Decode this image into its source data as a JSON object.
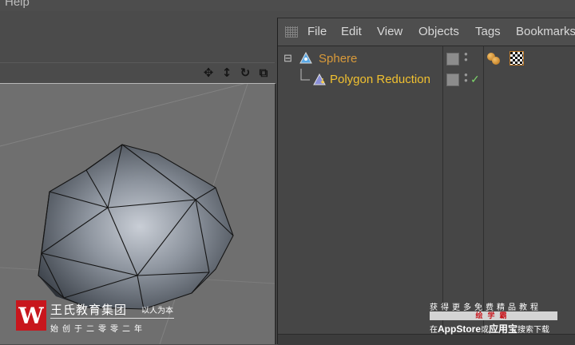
{
  "app_menu": {
    "help": "Help"
  },
  "viewport": {
    "tools": [
      {
        "icon": "move-view-icon",
        "glyph": "✥"
      },
      {
        "icon": "zoom-view-icon",
        "glyph": "↕"
      },
      {
        "icon": "rotate-view-icon",
        "glyph": "↻"
      },
      {
        "icon": "toggle-layout-icon",
        "glyph": "⧉"
      }
    ]
  },
  "object_manager": {
    "menu": [
      "File",
      "Edit",
      "View",
      "Objects",
      "Tags",
      "Bookmarks"
    ],
    "objects": [
      {
        "name": "Sphere",
        "color": "#d99a3a",
        "icon": "sphere-icon",
        "tags": [
          "material-sphere-tag",
          "checker-texture-tag"
        ]
      },
      {
        "name": "Polygon Reduction",
        "color": "#f0c030",
        "icon": "polygon-reduction-icon",
        "enabled": true
      }
    ],
    "colors": {
      "sphere": "#d99a3a",
      "polygon_reduction": "#f0c030",
      "checkmark": "#7dd36a"
    }
  },
  "watermark_left": {
    "logo_glyph": "W",
    "name": "王氏教育集团",
    "slogan": "以人为本",
    "sub": "始创于二零零二年"
  },
  "watermark_right": {
    "line1": "获得更多免费精品教程",
    "brand": "绘学霸",
    "line3_prefix": "在",
    "appstore": "AppStore",
    "or": "或",
    "yingyongbao": "应用宝",
    "line3_suffix": "搜索下载"
  }
}
